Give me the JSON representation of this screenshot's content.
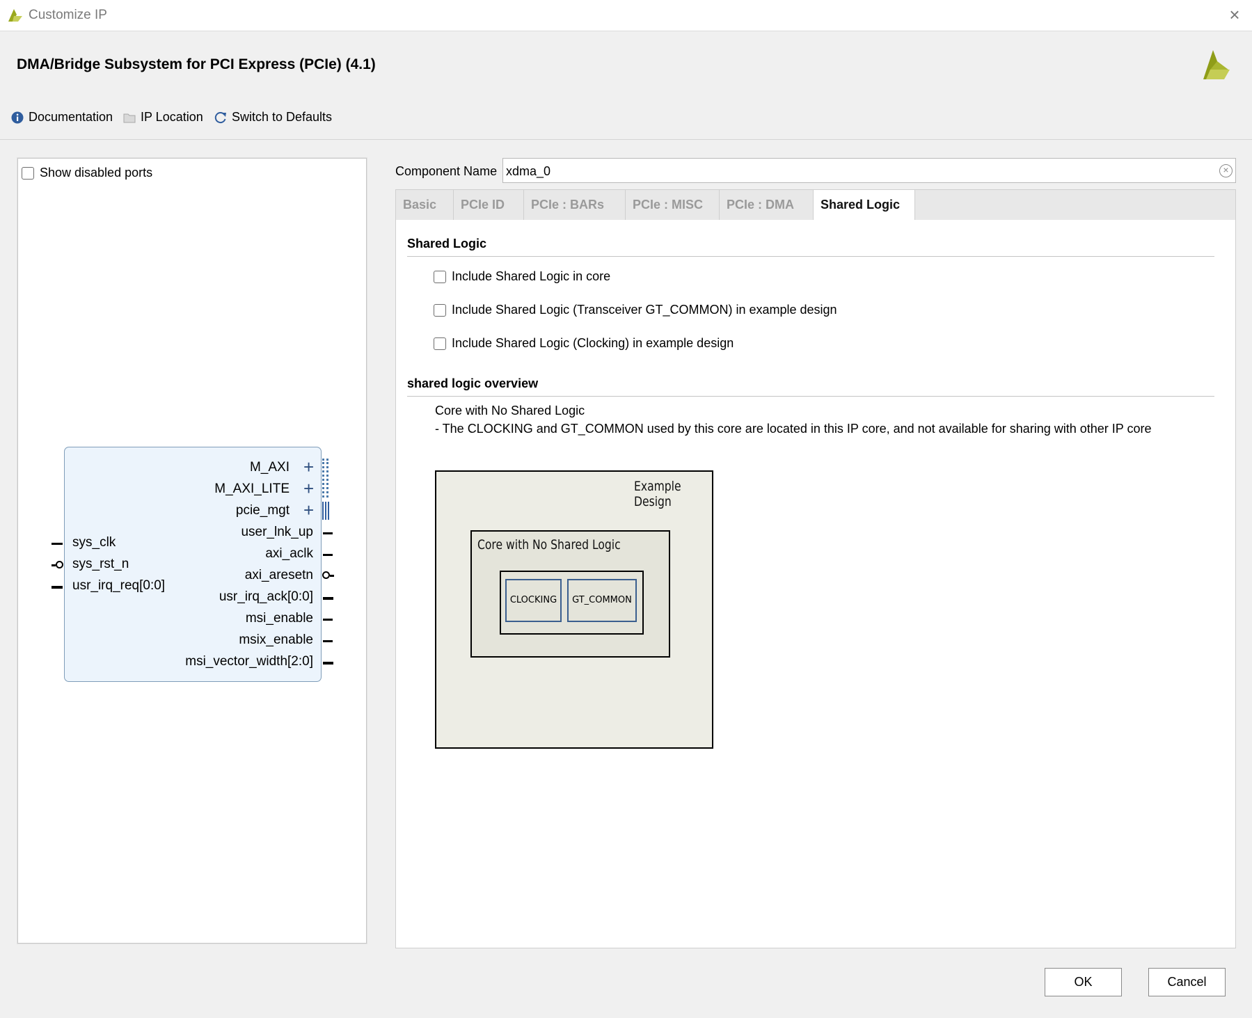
{
  "window": {
    "title": "Customize IP"
  },
  "header": {
    "ip_title": "DMA/Bridge Subsystem for PCI Express (PCIe) (4.1)",
    "toolbar": [
      {
        "label": "Documentation",
        "icon": "info-icon"
      },
      {
        "label": "IP Location",
        "icon": "folder-icon"
      },
      {
        "label": "Switch to Defaults",
        "icon": "refresh-icon"
      }
    ]
  },
  "left_panel": {
    "show_disabled_ports_label": "Show disabled ports",
    "show_disabled_ports_checked": false,
    "symbol": {
      "left_ports": [
        "sys_clk",
        "sys_rst_n",
        "usr_irq_req[0:0]"
      ],
      "right_bus_ports": [
        "M_AXI",
        "M_AXI_LITE",
        "pcie_mgt"
      ],
      "right_ports": [
        "user_lnk_up",
        "axi_aclk",
        "axi_aresetn",
        "usr_irq_ack[0:0]",
        "msi_enable",
        "msix_enable",
        "msi_vector_width[2:0]"
      ]
    }
  },
  "component": {
    "label": "Component Name",
    "value": "xdma_0"
  },
  "tabs": [
    "Basic",
    "PCIe ID",
    "PCIe : BARs",
    "PCIe : MISC",
    "PCIe : DMA",
    "Shared Logic"
  ],
  "active_tab": "Shared Logic",
  "shared_logic": {
    "section_title": "Shared Logic",
    "options": [
      {
        "label": "Include Shared Logic in core",
        "checked": false
      },
      {
        "label": "Include Shared Logic (Transceiver GT_COMMON) in example design",
        "checked": false
      },
      {
        "label": "Include Shared Logic (Clocking) in example design",
        "checked": false
      }
    ],
    "overview_title": "shared logic overview",
    "overview_heading": "Core with No Shared Logic",
    "overview_description": "- The CLOCKING and GT_COMMON used by this core are located in this IP core, and not available for sharing with other IP core",
    "diagram": {
      "outer_label": "Example Design",
      "core_label": "Core with No Shared Logic",
      "clocking_label": "CLOCKING",
      "gt_common_label": "GT_COMMON"
    }
  },
  "buttons": {
    "ok": "OK",
    "cancel": "Cancel"
  }
}
